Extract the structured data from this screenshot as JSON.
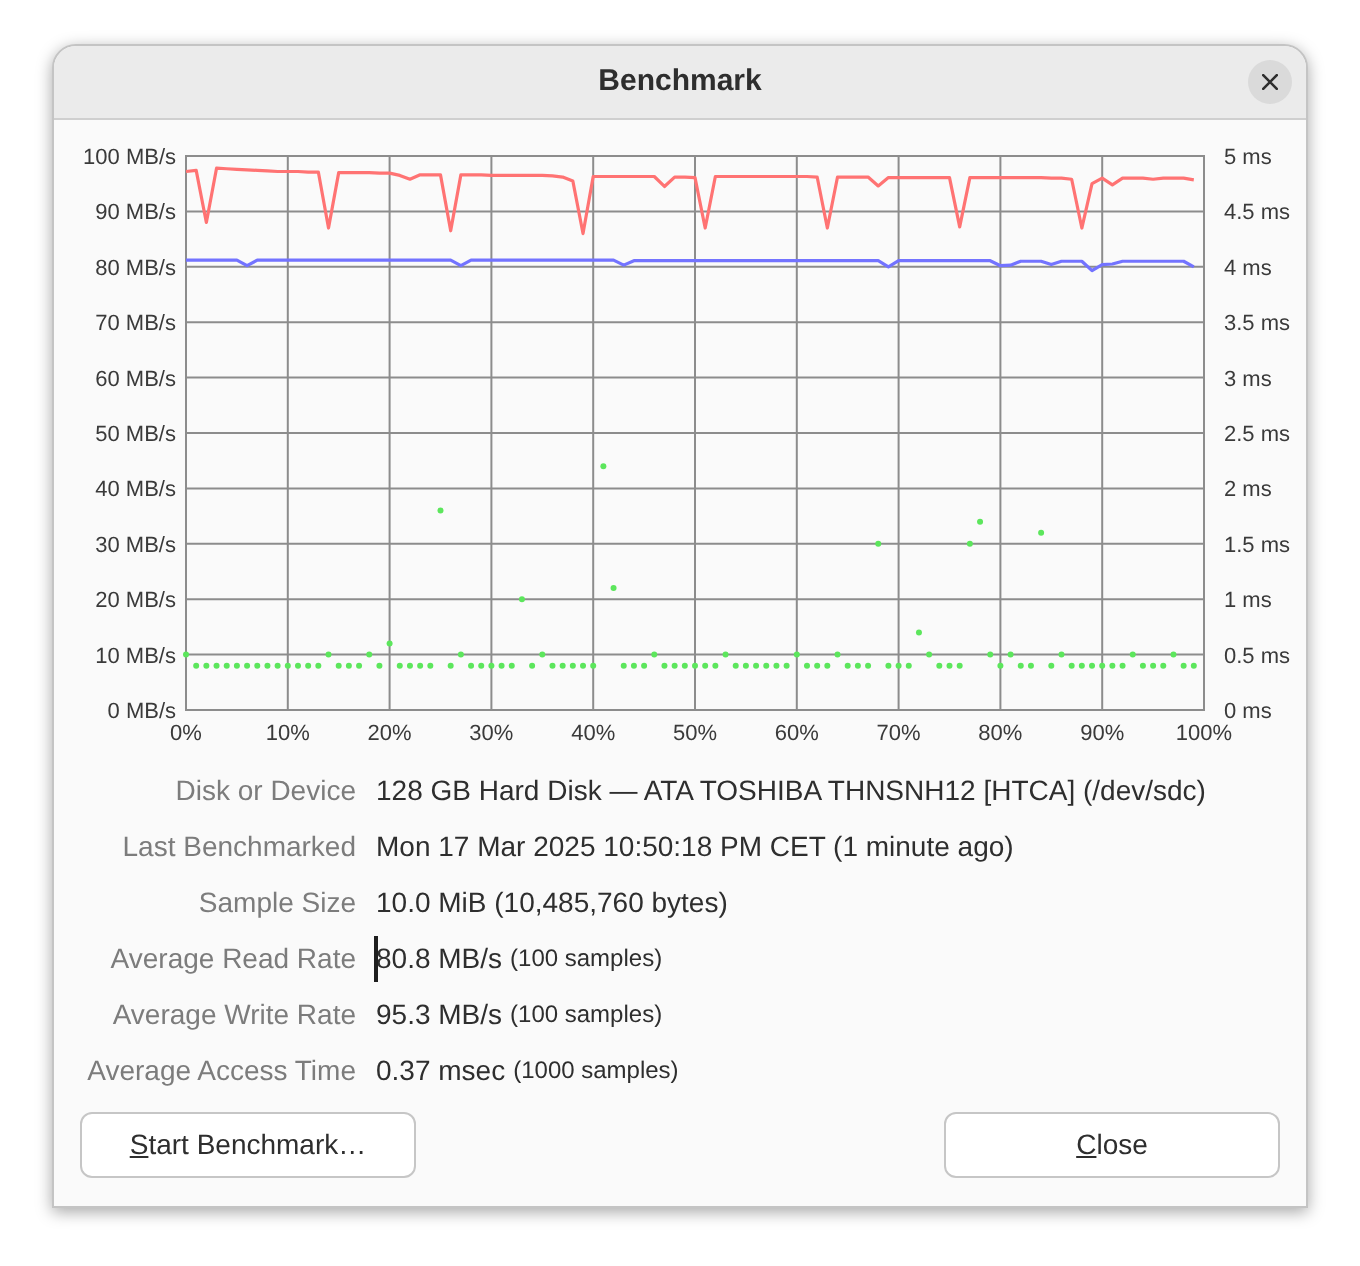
{
  "window": {
    "title": "Benchmark"
  },
  "chart": {
    "chart_data": {
      "type": "line",
      "grid": true,
      "x": [
        0,
        1,
        2,
        3,
        4,
        5,
        6,
        7,
        8,
        9,
        10,
        11,
        12,
        13,
        14,
        15,
        16,
        17,
        18,
        19,
        20,
        21,
        22,
        23,
        24,
        25,
        26,
        27,
        28,
        29,
        30,
        31,
        32,
        33,
        34,
        35,
        36,
        37,
        38,
        39,
        40,
        41,
        42,
        43,
        44,
        45,
        46,
        47,
        48,
        49,
        50,
        51,
        52,
        53,
        54,
        55,
        56,
        57,
        58,
        59,
        60,
        61,
        62,
        63,
        64,
        65,
        66,
        67,
        68,
        69,
        70,
        71,
        72,
        73,
        74,
        75,
        76,
        77,
        78,
        79,
        80,
        81,
        82,
        83,
        84,
        85,
        86,
        87,
        88,
        89,
        90,
        91,
        92,
        93,
        94,
        95,
        96,
        97,
        98,
        99
      ],
      "xlim": [
        0,
        100
      ],
      "ylim": [
        0,
        100
      ],
      "y2lim": [
        0,
        5
      ],
      "xticks": [
        {
          "value": 0,
          "label": "0%"
        },
        {
          "value": 10,
          "label": "10%"
        },
        {
          "value": 20,
          "label": "20%"
        },
        {
          "value": 30,
          "label": "30%"
        },
        {
          "value": 40,
          "label": "40%"
        },
        {
          "value": 50,
          "label": "50%"
        },
        {
          "value": 60,
          "label": "60%"
        },
        {
          "value": 70,
          "label": "70%"
        },
        {
          "value": 80,
          "label": "80%"
        },
        {
          "value": 90,
          "label": "90%"
        },
        {
          "value": 100,
          "label": "100%"
        }
      ],
      "yticks": [
        {
          "value": 100,
          "label": "100 MB/s"
        },
        {
          "value": 90,
          "label": "90 MB/s"
        },
        {
          "value": 80,
          "label": "80 MB/s"
        },
        {
          "value": 70,
          "label": "70 MB/s"
        },
        {
          "value": 60,
          "label": "60 MB/s"
        },
        {
          "value": 50,
          "label": "50 MB/s"
        },
        {
          "value": 40,
          "label": "40 MB/s"
        },
        {
          "value": 30,
          "label": "30 MB/s"
        },
        {
          "value": 20,
          "label": "20 MB/s"
        },
        {
          "value": 10,
          "label": "10 MB/s"
        },
        {
          "value": 0,
          "label": "0 MB/s"
        }
      ],
      "y2ticks": [
        {
          "value": 5,
          "label": "5 ms"
        },
        {
          "value": 4.5,
          "label": "4.5 ms"
        },
        {
          "value": 4,
          "label": "4 ms"
        },
        {
          "value": 3.5,
          "label": "3.5 ms"
        },
        {
          "value": 3,
          "label": "3 ms"
        },
        {
          "value": 2.5,
          "label": "2.5 ms"
        },
        {
          "value": 2,
          "label": "2 ms"
        },
        {
          "value": 1.5,
          "label": "1.5 ms"
        },
        {
          "value": 1,
          "label": "1 ms"
        },
        {
          "value": 0.5,
          "label": "0.5 ms"
        },
        {
          "value": 0,
          "label": "0 ms"
        }
      ],
      "series": [
        {
          "color": "#ff7373",
          "values": [
            97.2,
            97.4,
            88,
            97.8,
            97.7,
            97.6,
            97.5,
            97.4,
            97.3,
            97.2,
            97.2,
            97.2,
            97.1,
            97.1,
            87,
            97,
            97,
            97,
            97,
            96.9,
            96.9,
            96.5,
            95.8,
            96.6,
            96.6,
            96.6,
            86.5,
            96.6,
            96.6,
            96.6,
            96.5,
            96.5,
            96.5,
            96.5,
            96.5,
            96.5,
            96.4,
            96.2,
            95.5,
            86,
            96.3,
            96.3,
            96.3,
            96.3,
            96.3,
            96.3,
            96.3,
            94.5,
            96.2,
            96.2,
            96.1,
            87,
            96.3,
            96.3,
            96.3,
            96.3,
            96.3,
            96.3,
            96.3,
            96.3,
            96.3,
            96.3,
            96.2,
            87,
            96.2,
            96.2,
            96.2,
            96.2,
            94.6,
            96.1,
            96.1,
            96.1,
            96.1,
            96.1,
            96.1,
            96.1,
            87.2,
            96.1,
            96.1,
            96.1,
            96.1,
            96.1,
            96.1,
            96.1,
            96.1,
            96,
            96,
            95.8,
            87,
            95,
            96,
            94.8,
            96,
            96,
            96,
            95.8,
            96,
            96,
            96,
            95.7
          ]
        },
        {
          "color": "#7373ff",
          "values": [
            81.2,
            81.2,
            81.2,
            81.2,
            81.2,
            81.2,
            80.2,
            81.2,
            81.2,
            81.2,
            81.2,
            81.2,
            81.2,
            81.2,
            81.2,
            81.2,
            81.2,
            81.2,
            81.2,
            81.2,
            81.2,
            81.2,
            81.2,
            81.2,
            81.2,
            81.2,
            81.2,
            80.2,
            81.2,
            81.2,
            81.2,
            81.2,
            81.2,
            81.2,
            81.2,
            81.2,
            81.2,
            81.2,
            81.2,
            81.2,
            81.2,
            81.2,
            81.2,
            80.3,
            81.1,
            81.1,
            81.1,
            81.1,
            81.1,
            81.1,
            81.1,
            81.1,
            81.1,
            81.1,
            81.1,
            81.1,
            81.1,
            81.1,
            81.1,
            81.1,
            81.1,
            81.1,
            81.1,
            81.1,
            81.1,
            81.1,
            81.1,
            81.1,
            81.1,
            80,
            81.1,
            81.1,
            81.1,
            81.1,
            81.1,
            81.1,
            81.1,
            81.1,
            81.1,
            81.1,
            80.2,
            80.3,
            81,
            81,
            81,
            80.4,
            81,
            81,
            81,
            79.3,
            80.4,
            80.5,
            81,
            81,
            81,
            81,
            81,
            81,
            81,
            80
          ]
        },
        {
          "type": "scatter",
          "axis": "y2",
          "color": "#5ce65c",
          "values": [
            0.5,
            0.4,
            0.4,
            0.4,
            0.4,
            0.4,
            0.4,
            0.4,
            0.4,
            0.4,
            0.4,
            0.4,
            0.4,
            0.4,
            0.5,
            0.4,
            0.4,
            0.4,
            0.5,
            0.4,
            0.6,
            0.4,
            0.4,
            0.4,
            0.4,
            1.8,
            0.4,
            0.5,
            0.4,
            0.4,
            0.4,
            0.4,
            0.4,
            1,
            0.4,
            0.5,
            0.4,
            0.4,
            0.4,
            0.4,
            0.4,
            2.2,
            1.1,
            0.4,
            0.4,
            0.4,
            0.5,
            0.4,
            0.4,
            0.4,
            0.4,
            0.4,
            0.4,
            0.5,
            0.4,
            0.4,
            0.4,
            0.4,
            0.4,
            0.4,
            0.5,
            0.4,
            0.4,
            0.4,
            0.5,
            0.4,
            0.4,
            0.4,
            1.5,
            0.4,
            0.4,
            0.4,
            0.7,
            0.5,
            0.4,
            0.4,
            0.4,
            1.5,
            1.7,
            0.5,
            0.4,
            0.5,
            0.4,
            0.4,
            1.6,
            0.4,
            0.5,
            0.4,
            0.4,
            0.4,
            0.4,
            0.4,
            0.4,
            0.5,
            0.4,
            0.4,
            0.4,
            0.5,
            0.4,
            0.4
          ]
        }
      ]
    }
  },
  "details": [
    {
      "label": "Disk or Device",
      "value": "128 GB Hard Disk — ATA TOSHIBA THNSNH12 [HTCA] (/dev/sdc)",
      "text_cursor": false
    },
    {
      "label": "Last Benchmarked",
      "value": "Mon 17 Mar 2025 10:50:18 PM CET (1 minute ago)",
      "text_cursor": false
    },
    {
      "label": "Sample Size",
      "value": "10.0 MiB (10,485,760 bytes)",
      "text_cursor": false
    },
    {
      "label": "Average Read Rate",
      "value": "80.8 MB/s",
      "note": "(100 samples)",
      "text_cursor": true
    },
    {
      "label": "Average Write Rate",
      "value": "95.3 MB/s",
      "note": "(100 samples)",
      "text_cursor": false
    },
    {
      "label": "Average Access Time",
      "value": "0.37 msec",
      "note": "(1000 samples)",
      "text_cursor": false
    }
  ],
  "buttons": [
    {
      "label": "Start Benchmark…",
      "mnemonic_underlined": true
    },
    {
      "label": "Close",
      "mnemonic_underlined": true
    }
  ]
}
